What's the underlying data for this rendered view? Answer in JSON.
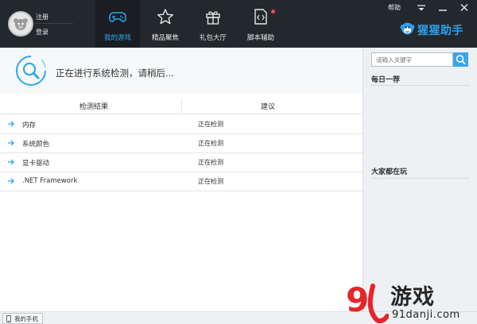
{
  "account": {
    "register_label": "注册",
    "login_label": "登录"
  },
  "nav_tabs": [
    {
      "label": "我的游戏",
      "icon": "gamepad-icon",
      "active": true
    },
    {
      "label": "精品聚焦",
      "icon": "star-icon",
      "active": false
    },
    {
      "label": "礼包大厅",
      "icon": "gift-icon",
      "active": false
    },
    {
      "label": "脚本辅助",
      "icon": "script-file-icon",
      "active": false,
      "badge": true
    }
  ],
  "window_controls": {
    "help_label": "帮助",
    "icons": [
      "menu-icon",
      "minimize-icon",
      "close-icon"
    ]
  },
  "brand": {
    "name": "猩猩助手",
    "icon": "monkey-icon",
    "color": "#2f9ff0"
  },
  "scan": {
    "status_text": "正在进行系统检测，请稍后..."
  },
  "table": {
    "headers": [
      "检测结果",
      "建议"
    ],
    "rows": [
      {
        "item": "内存",
        "status": "正在检测"
      },
      {
        "item": "系统颜色",
        "status": "正在检测"
      },
      {
        "item": "显卡驱动",
        "status": "正在检测"
      },
      {
        "item": ".NET Framework",
        "status": "正在检测"
      }
    ]
  },
  "sidebar": {
    "search_placeholder": "请输入关键字",
    "daily_title": "每日一荐",
    "popular_title": "大家都在玩"
  },
  "bottom": {
    "phone_label": "我的手机"
  },
  "watermark": {
    "logo_text": "9",
    "name": "游戏",
    "domain": "91danji.com"
  },
  "colors": {
    "topbar_bg": "#23282d",
    "accent": "#2ea7ee",
    "badge": "#e94b5b"
  }
}
